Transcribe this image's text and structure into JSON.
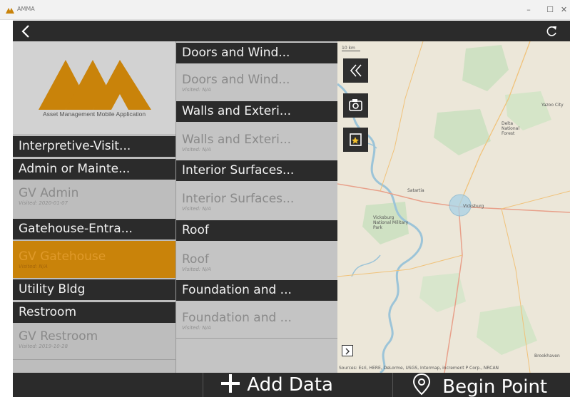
{
  "window": {
    "title": "AMMA",
    "minimize": "–",
    "maximize": "☐",
    "close": "✕"
  },
  "appbar": {
    "back_icon": "chevron-left-icon",
    "refresh_icon": "refresh-icon"
  },
  "logo": {
    "caption": "Asset Management Mobile Application",
    "brand_color": "#c9830a"
  },
  "locations": [
    {
      "type": "header",
      "label": "Interpretive-Visit..."
    },
    {
      "type": "header",
      "label": "Admin or Mainte..."
    },
    {
      "type": "asset",
      "label": "GV Admin",
      "visited": "Visited: 2020-01-07"
    },
    {
      "type": "header",
      "label": "Gatehouse-Entra..."
    },
    {
      "type": "asset",
      "label": "GV Gatehouse",
      "visited": "Visited: N/A",
      "selected": true
    },
    {
      "type": "header",
      "label": "Utility Bldg"
    },
    {
      "type": "header",
      "label": "Restroom"
    },
    {
      "type": "asset",
      "label": "GV Restroom",
      "visited": "Visited: 2019-10-28"
    }
  ],
  "components": [
    {
      "type": "header",
      "label": "Doors and Wind..."
    },
    {
      "type": "asset",
      "label": "Doors and Wind...",
      "visited": "Visited: N/A"
    },
    {
      "type": "header",
      "label": "Walls and Exteri..."
    },
    {
      "type": "asset",
      "label": "Walls and Exteri...",
      "visited": "Visited: N/A"
    },
    {
      "type": "header",
      "label": "Interior Surfaces..."
    },
    {
      "type": "asset",
      "label": "Interior Surfaces...",
      "visited": "Visited: N/A"
    },
    {
      "type": "header",
      "label": "Roof"
    },
    {
      "type": "asset",
      "label": "Roof",
      "visited": "Visited: N/A"
    },
    {
      "type": "header",
      "label": "Foundation and ..."
    },
    {
      "type": "asset",
      "label": "Foundation and ...",
      "visited": "Visited: N/A"
    }
  ],
  "map": {
    "scale_label": "10 km",
    "places": [
      "Yazoo City",
      "Delta National Forest",
      "Satartia",
      "Vicksburg",
      "Vicksburg National Military Park",
      "Brookhaven"
    ],
    "attribution": "Sources: Esri, HERE, DeLorme, USGS, Intermap, increment P Corp., NRCAN",
    "buttons": [
      "collapse-panel-icon",
      "camera-icon",
      "star-note-icon"
    ],
    "expand_icon": "chevron-right-icon"
  },
  "bottombar": {
    "add_data_label": "Add Data",
    "begin_point_label": "Begin Point"
  }
}
